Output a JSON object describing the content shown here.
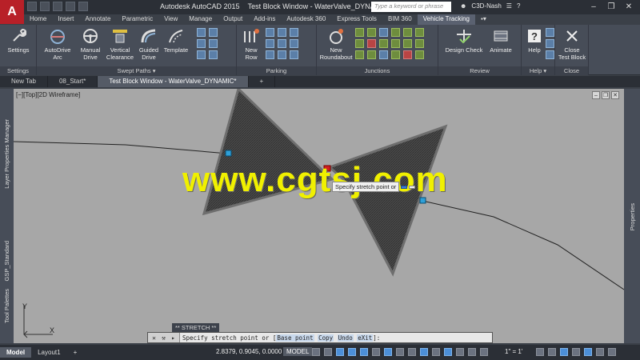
{
  "app": {
    "logo_letter": "A",
    "product": "Autodesk AutoCAD 2015",
    "window_title": "Test Block Window - WaterValve_DYNAMIC",
    "search_placeholder": "Type a keyword or phrase",
    "user": "C3D-Nash"
  },
  "ribbon_tabs": [
    "Home",
    "Insert",
    "Annotate",
    "Parametric",
    "View",
    "Manage",
    "Output",
    "Add-ins",
    "Autodesk 360",
    "Express Tools",
    "BIM 360",
    "Vehicle Tracking"
  ],
  "active_ribbon_tab": "Vehicle Tracking",
  "ribbon": {
    "settings": {
      "tool": "Settings",
      "panel": "Settings"
    },
    "swept_paths": {
      "panel": "Swept Paths",
      "tools": [
        "AutoDrive\nArc",
        "Manual\nDrive",
        "Vertical\nClearance",
        "Guided\nDrive",
        "Template"
      ]
    },
    "parking": {
      "panel": "Parking",
      "tool": "New\nRow"
    },
    "junctions": {
      "panel": "Junctions",
      "tool": "New\nRoundabout"
    },
    "review": {
      "panel": "Review",
      "tools": [
        "Design Check",
        "Animate"
      ]
    },
    "help": {
      "panel": "Help",
      "tool": "Help"
    },
    "close": {
      "panel": "Close",
      "tool": "Close\nTest Block"
    }
  },
  "doc_tabs": [
    "New Tab",
    "08_Start*",
    "Test Block Window - WaterValve_DYNAMIC*"
  ],
  "active_doc_tab": "Test Block Window - WaterValve_DYNAMIC*",
  "viewport": {
    "label": "[−][Top][2D Wireframe]",
    "ucs_x": "X",
    "ucs_y": "Y"
  },
  "palettes": {
    "left_top": "Layer Properties Manager",
    "left_mid": "GSP_Standard",
    "left_bottom": "Tool Palettes",
    "right": "Properties"
  },
  "watermark": "www.cgtsj.com",
  "dynamic_input": {
    "prompt": "Specify stretch point or",
    "value_1": "",
    "value_2": ""
  },
  "command": {
    "history": "** STRETCH **",
    "prompt_prefix": "Specify stretch point or [",
    "options": [
      "Base point",
      "Copy",
      "Undo",
      "eXit"
    ],
    "prompt_suffix": "]:"
  },
  "status": {
    "layout_tabs": [
      "Model",
      "Layout1"
    ],
    "active_layout": "Model",
    "coordinates": "2.8379, 0.9045, 0.0000",
    "model_label": "MODEL",
    "annotation_scale": "1\" = 1'"
  },
  "colors": {
    "viewport_bg": "#a7a7a7",
    "ribbon_bg": "#474d58",
    "watermark": "#f0f000",
    "grip_blue": "#2ea0d8",
    "grip_red": "#d02020"
  }
}
